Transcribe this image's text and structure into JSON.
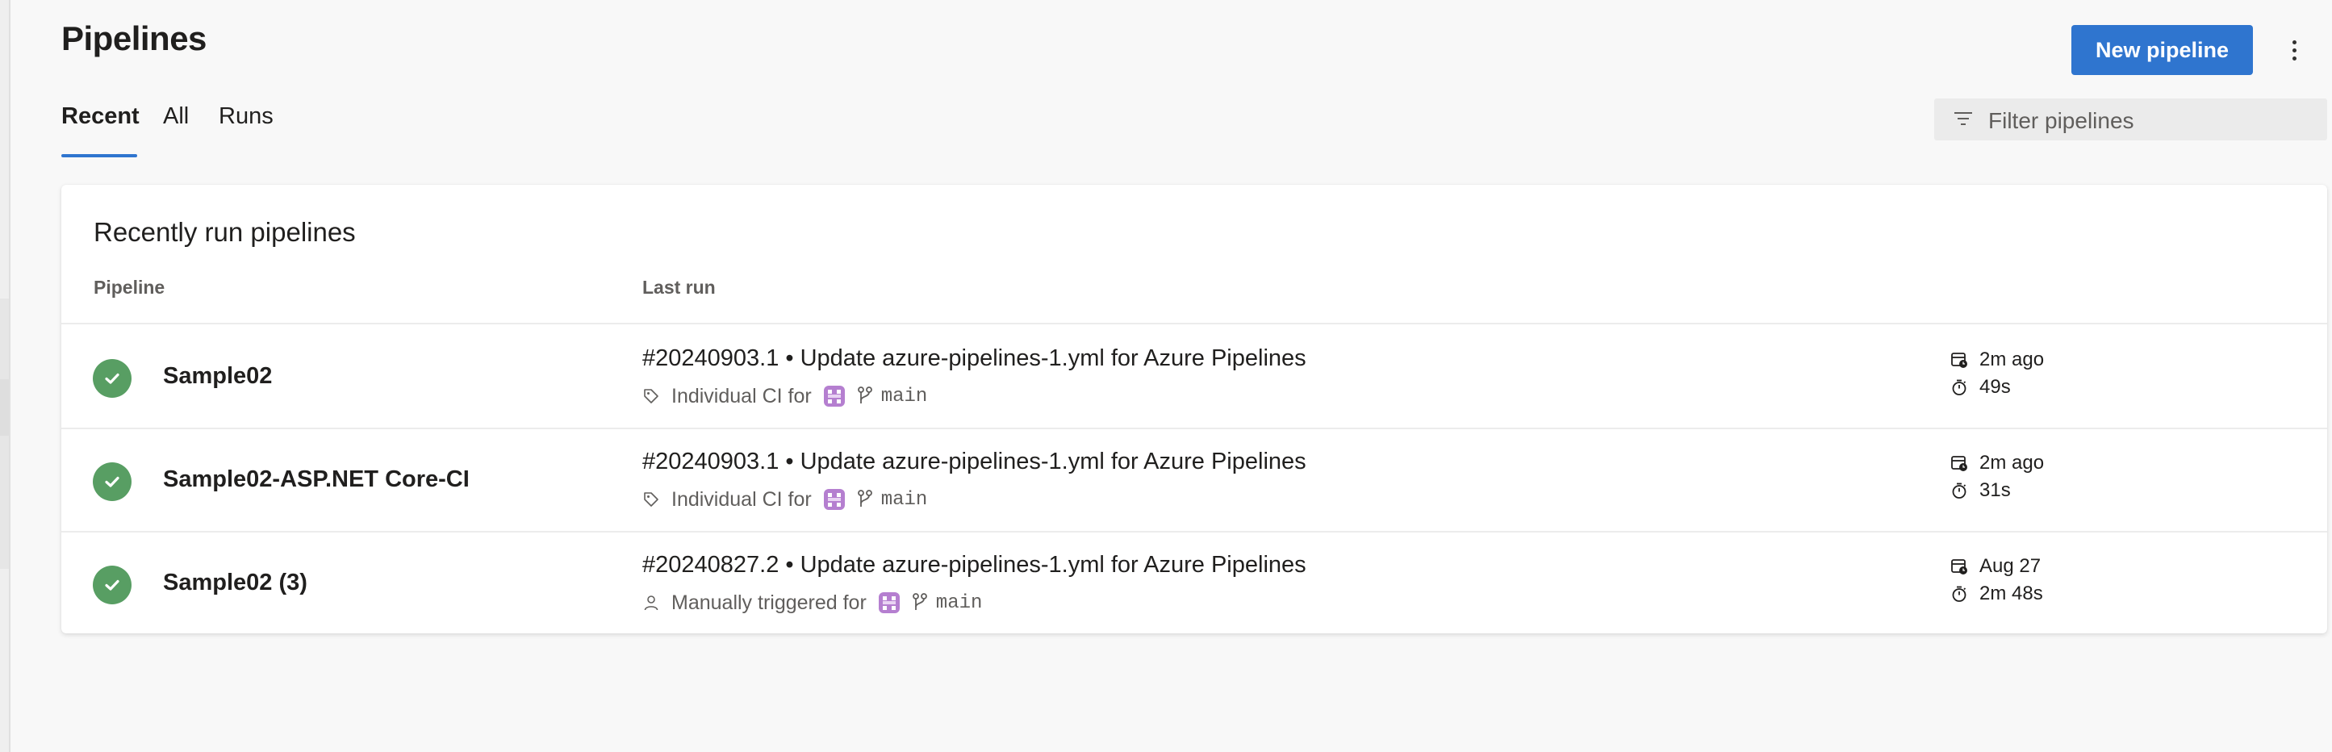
{
  "page": {
    "title": "Pipelines",
    "new_button_label": "New pipeline"
  },
  "tabs": [
    {
      "label": "Recent",
      "active": true
    },
    {
      "label": "All",
      "active": false
    },
    {
      "label": "Runs",
      "active": false
    }
  ],
  "filter": {
    "placeholder": "Filter pipelines",
    "icon": "filter-icon"
  },
  "card": {
    "title": "Recently run pipelines",
    "columns": {
      "pipeline": "Pipeline",
      "last_run": "Last run"
    }
  },
  "rows": [
    {
      "status": "succeeded",
      "name": "Sample02",
      "run_title": "#20240903.1 • Update azure-pipelines-1.yml for Azure Pipelines",
      "trigger_icon": "tag-icon",
      "trigger_text": "Individual CI for",
      "branch": "main",
      "when": "2m ago",
      "duration": "49s"
    },
    {
      "status": "succeeded",
      "name": "Sample02-ASP.NET Core-CI",
      "run_title": "#20240903.1 • Update azure-pipelines-1.yml for Azure Pipelines",
      "trigger_icon": "tag-icon",
      "trigger_text": "Individual CI for",
      "branch": "main",
      "when": "2m ago",
      "duration": "31s"
    },
    {
      "status": "succeeded",
      "name": "Sample02 (3)",
      "run_title": "#20240827.2 • Update azure-pipelines-1.yml for Azure Pipelines",
      "trigger_icon": "person-icon",
      "trigger_text": "Manually triggered for",
      "branch": "main",
      "when": "Aug 27",
      "duration": "2m 48s"
    }
  ],
  "colors": {
    "accent": "#2f75cf",
    "success": "#589e63",
    "avatar": "#b57fd0"
  }
}
